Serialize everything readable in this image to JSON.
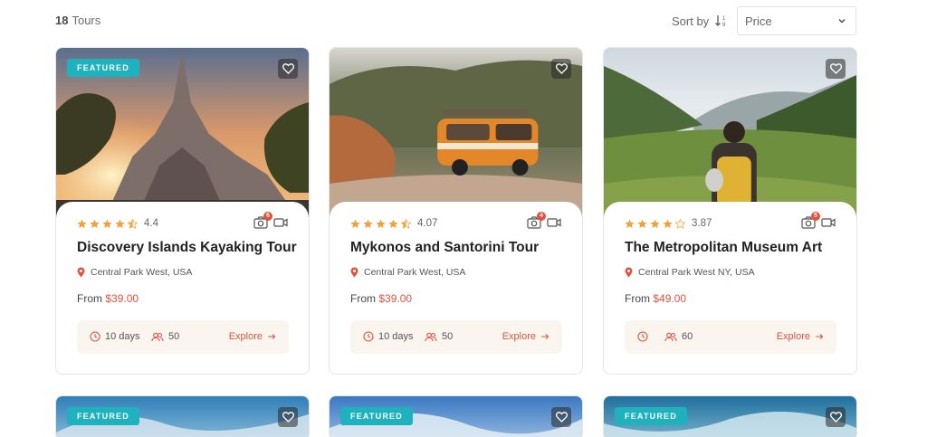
{
  "results": {
    "count": "18",
    "label": "Tours"
  },
  "sort": {
    "label": "Sort by",
    "selected": "Price"
  },
  "colors": {
    "accent": "#e0533e",
    "badge": "#1fb2be",
    "star": "#f0a13a"
  },
  "tours": [
    {
      "badge": "FEATURED",
      "rating": "4.4",
      "stars": 4.5,
      "photo_count": "6",
      "title": "Discovery Islands Kayaking Tour",
      "location": "Central Park West, USA",
      "from_label": "From",
      "price": "$39.00",
      "days": "10 days",
      "group": "50",
      "explore": "Explore"
    },
    {
      "badge": "",
      "rating": "4.07",
      "stars": 4.5,
      "photo_count": "4",
      "title": "Mykonos and Santorini Tour",
      "location": "Central Park West, USA",
      "from_label": "From",
      "price": "$39.00",
      "days": "10 days",
      "group": "50",
      "explore": "Explore"
    },
    {
      "badge": "",
      "rating": "3.87",
      "stars": 4,
      "photo_count": "5",
      "title": "The Metropolitan Museum Art",
      "location": "Central Park West NY, USA",
      "from_label": "From",
      "price": "$49.00",
      "days": "",
      "group": "60",
      "explore": "Explore"
    }
  ],
  "next_row": [
    {
      "badge": "FEATURED"
    },
    {
      "badge": "FEATURED"
    },
    {
      "badge": "FEATURED"
    }
  ]
}
